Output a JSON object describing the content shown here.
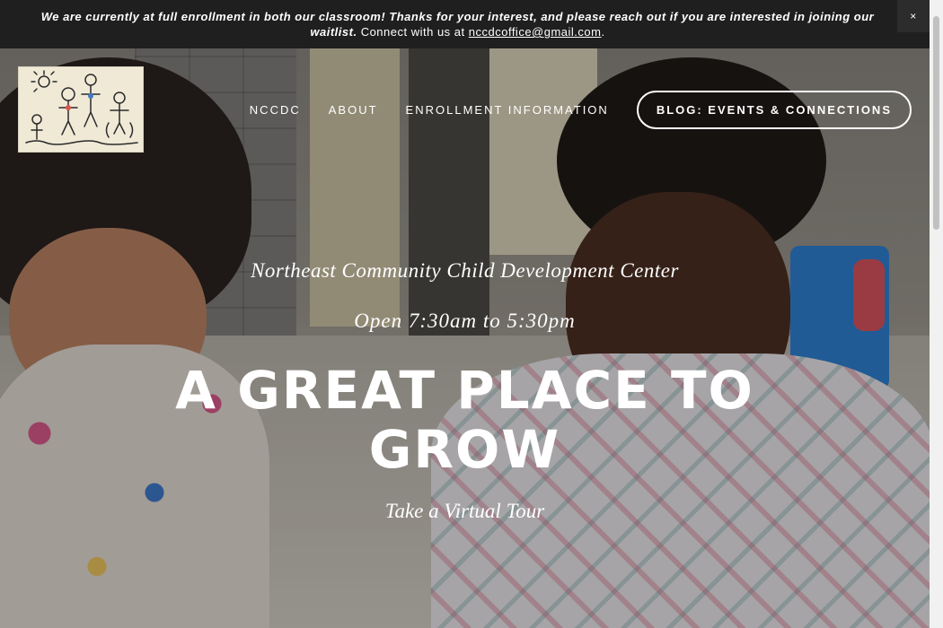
{
  "announcement": {
    "bold_text": "We are currently at full enrollment in both our classroom!  Thanks for your interest, and please reach out if you are interested in joining our waitlist.",
    "plain_text": " Connect with us at ",
    "email": "nccdcoffice@gmail.com",
    "period": ".",
    "close_label": "×"
  },
  "nav": {
    "items": [
      "NCCDC",
      "ABOUT",
      "ENROLLMENT INFORMATION"
    ],
    "cta": "BLOG: EVENTS & CONNECTIONS"
  },
  "hero": {
    "subtitle": "Northeast Community Child Development Center",
    "hours": "Open 7:30am to 5:30pm",
    "headline": "A GREAT PLACE TO GROW",
    "tour_link": "Take a Virtual Tour"
  }
}
